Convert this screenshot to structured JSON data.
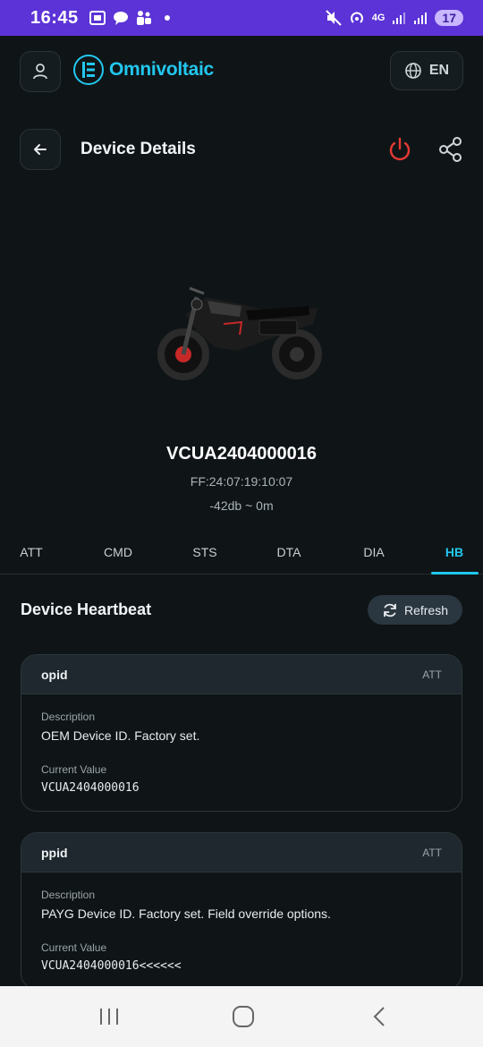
{
  "status_bar": {
    "time": "16:45",
    "network": "4G",
    "battery": "17",
    "icons": [
      "screenshot-icon",
      "chat-icon",
      "teams-icon",
      "dot-icon",
      "mute-icon",
      "hotspot-icon",
      "signal-icon",
      "signal-icon-2"
    ]
  },
  "app": {
    "brand": "Omnivoltaic",
    "language": "EN",
    "accent_color": "#22c7ee"
  },
  "header": {
    "title": "Device Details"
  },
  "device": {
    "name": "VCUA2404000016",
    "mac": "FF:24:07:19:10:07",
    "signal": "-42db ~ 0m"
  },
  "tabs": [
    {
      "label": "ATT",
      "active": false
    },
    {
      "label": "CMD",
      "active": false
    },
    {
      "label": "STS",
      "active": false
    },
    {
      "label": "DTA",
      "active": false
    },
    {
      "label": "DIA",
      "active": false
    },
    {
      "label": "HB",
      "active": true
    }
  ],
  "section": {
    "title": "Device Heartbeat",
    "refresh_label": "Refresh"
  },
  "cards": [
    {
      "key": "opid",
      "tag": "ATT",
      "description_label": "Description",
      "description": "OEM Device ID. Factory set.",
      "value_label": "Current Value",
      "value": "VCUA2404000016"
    },
    {
      "key": "ppid",
      "tag": "ATT",
      "description_label": "Description",
      "description": "PAYG Device ID. Factory set. Field override options.",
      "value_label": "Current Value",
      "value": "VCUA2404000016<<<<<<"
    }
  ]
}
